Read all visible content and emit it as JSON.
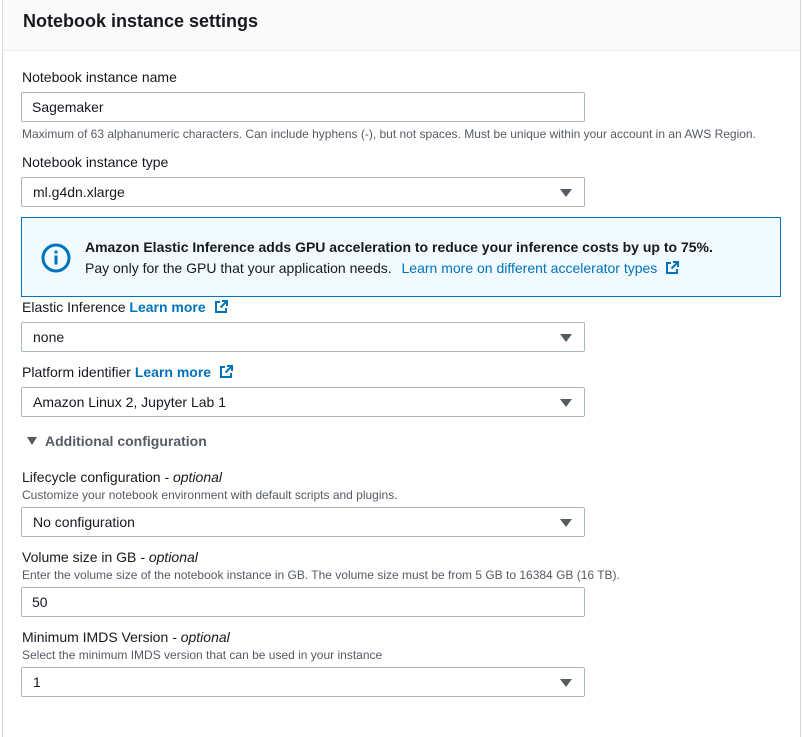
{
  "panel": {
    "title": "Notebook instance settings"
  },
  "name_field": {
    "label": "Notebook instance name",
    "value": "Sagemaker",
    "hint": "Maximum of 63 alphanumeric characters. Can include hyphens (-), but not spaces. Must be unique within your account in an AWS Region."
  },
  "type_field": {
    "label": "Notebook instance type",
    "value": "ml.g4dn.xlarge"
  },
  "info_alert": {
    "title": "Amazon Elastic Inference adds GPU acceleration to reduce your inference costs by up to 75%.",
    "body": "Pay only for the GPU that your application needs.",
    "link": "Learn more on different accelerator types"
  },
  "elastic_inference": {
    "label": "Elastic Inference",
    "link": "Learn more",
    "value": "none"
  },
  "platform": {
    "label": "Platform identifier",
    "link": "Learn more",
    "value": "Amazon Linux 2, Jupyter Lab 1"
  },
  "additional": {
    "label": "Additional configuration"
  },
  "lifecycle": {
    "label": "Lifecycle configuration",
    "optional": "- optional",
    "hint": "Customize your notebook environment with default scripts and plugins.",
    "value": "No configuration"
  },
  "volume": {
    "label": "Volume size in GB",
    "optional": "- optional",
    "hint": "Enter the volume size of the notebook instance in GB. The volume size must be from 5 GB to 16384 GB (16 TB).",
    "value": "50"
  },
  "imds": {
    "label": "Minimum IMDS Version",
    "optional": "- optional",
    "hint": "Select the minimum IMDS version that can be used in your instance",
    "value": "1"
  },
  "colors": {
    "accent": "#0073bb",
    "alert_bg": "#f1faff",
    "text": "#16191f",
    "muted": "#545b64"
  }
}
